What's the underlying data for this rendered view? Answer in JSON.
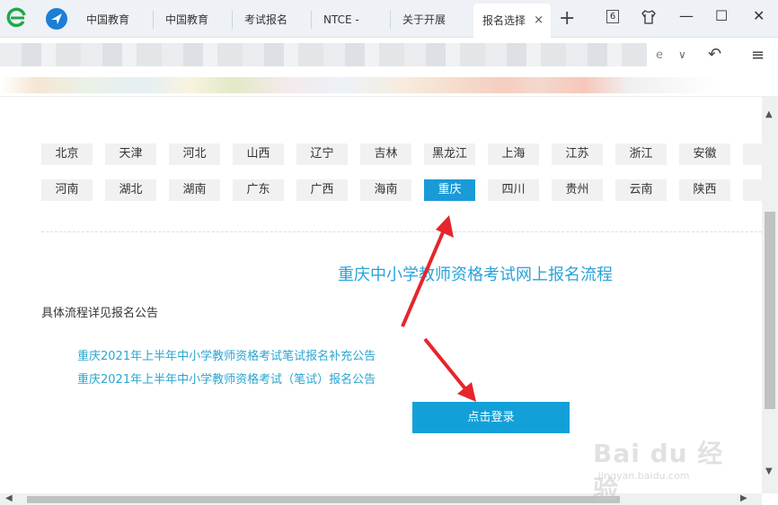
{
  "browser": {
    "tabs": [
      {
        "label": "中国教育",
        "active": false
      },
      {
        "label": "中国教育",
        "active": false
      },
      {
        "label": "考试报名",
        "active": false
      },
      {
        "label": "NTCE - ",
        "active": false
      },
      {
        "label": "关于开展",
        "active": false
      },
      {
        "label": "报名选择",
        "active": true
      }
    ],
    "close_glyph": "×",
    "new_tab_glyph": "+",
    "tab_count": "6",
    "window_controls": {
      "minimize": "—",
      "maximize": "☐",
      "close": "✕"
    },
    "address": {
      "compat_icon": "e",
      "dropdown": "∨",
      "undo": "↶",
      "menu": "≡"
    }
  },
  "page": {
    "provinces_row1": [
      "北京",
      "天津",
      "河北",
      "山西",
      "辽宁",
      "吉林",
      "黑龙江",
      "上海",
      "江苏",
      "浙江",
      "安徽",
      "福"
    ],
    "provinces_row2": [
      "河南",
      "湖北",
      "湖南",
      "广东",
      "广西",
      "海南",
      "重庆",
      "四川",
      "贵州",
      "云南",
      "陕西",
      "甘"
    ],
    "selected_province": "重庆",
    "title": "重庆中小学教师资格考试网上报名流程",
    "description": "具体流程详见报名公告",
    "links": [
      "重庆2021年上半年中小学教师资格考试笔试报名补充公告",
      "重庆2021年上半年中小学教师资格考试（笔试）报名公告"
    ],
    "login_button": "点击登录"
  },
  "watermark": {
    "main": "Bai du 经验",
    "sub": "jingyan.baidu.com"
  },
  "colors": {
    "accent": "#1a9ad6",
    "link": "#2aa5d1",
    "arrow": "#e5262b"
  }
}
